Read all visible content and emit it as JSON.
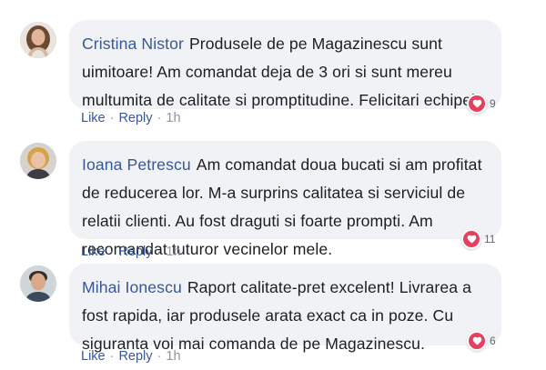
{
  "comments": [
    {
      "author": "Cristina Nistor",
      "text": "Produsele de pe Magazinescu sunt uimitoare! Am comandat deja de 3 ori si sunt mereu multumita de calitate si promptitudine. Felicitari echipei!",
      "reactions": "9",
      "like": "Like",
      "reply": "Reply",
      "time": "1h",
      "separator": "·"
    },
    {
      "author": "Ioana Petrescu",
      "text": "Am comandat doua bucati si am profitat de reducerea lor. M-a surprins calitatea si serviciul de relatii clienti. Au fost draguti si foarte prompti. Am recomandat tuturor vecinelor mele.",
      "reactions": "11",
      "like": "Like",
      "reply": "Reply",
      "time": "1h",
      "separator": "·"
    },
    {
      "author": "Mihai Ionescu",
      "text": "Raport calitate-pret excelent! Livrarea a fost rapida, iar produsele arata exact ca in poze. Cu siguranta voi mai comanda de pe Magazinescu.",
      "reactions": "6",
      "like": "Like",
      "reply": "Reply",
      "time": "1h",
      "separator": "·"
    }
  ],
  "colors": {
    "author": "#385898",
    "bubble": "#f0f2f5",
    "heart": "#e4405f",
    "meta": "#90949c"
  },
  "icons": {
    "reaction": "heart-icon",
    "avatar": "user-avatar"
  }
}
